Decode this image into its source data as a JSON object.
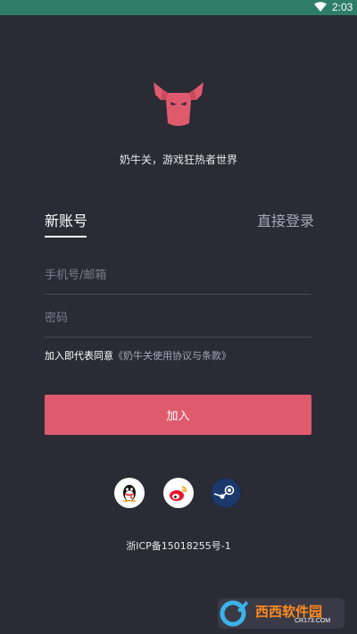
{
  "status_bar": {
    "time": "2:03",
    "wifi_icon": "wifi-icon"
  },
  "logo": {
    "icon": "bull-head-icon",
    "color": "#e05a6d"
  },
  "slogan": "奶牛关，游戏狂热者世界",
  "tabs": {
    "new_account": "新账号",
    "direct_login": "直接登录"
  },
  "form": {
    "phone_placeholder": "手机号/邮箱",
    "password_placeholder": "密码"
  },
  "agreement": {
    "prefix": "加入即代表同意",
    "link": "《奶牛关使用协议与条款》"
  },
  "join_button": {
    "label": "加入",
    "color": "#e05a6d"
  },
  "social_login": [
    "qq-icon",
    "weibo-icon",
    "steam-icon"
  ],
  "icp": "浙ICP备15018255号-1",
  "watermark": {
    "text": "西西软件园",
    "sub": "CR173.COM"
  },
  "colors": {
    "background": "#2b2b36",
    "status_bar": "#2e7d68",
    "accent": "#e05a6d"
  }
}
